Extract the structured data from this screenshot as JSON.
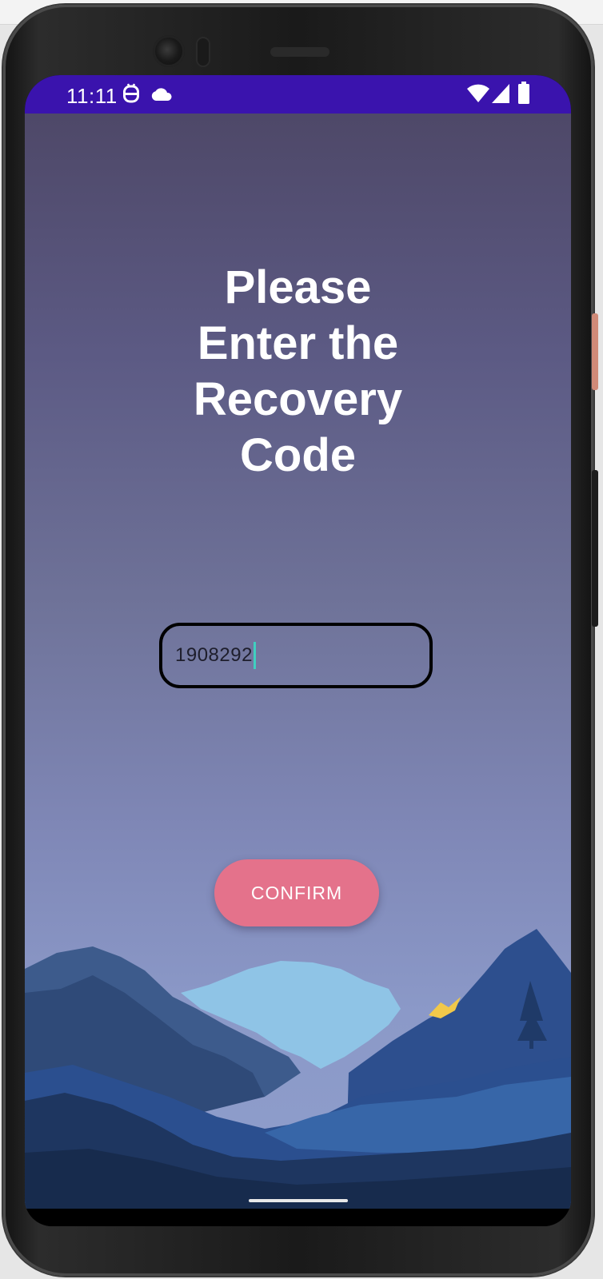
{
  "status_bar": {
    "time": "11:11",
    "left_icons": [
      "system-notification-icon",
      "cloud-icon"
    ],
    "right_icons": [
      "wifi-icon",
      "cellular-signal-icon",
      "battery-icon"
    ],
    "background_color": "#3a13ad"
  },
  "screen": {
    "title_lines": [
      "Please",
      "Enter the",
      "Recovery",
      "Code"
    ],
    "recovery_code_input": {
      "value": "1908292",
      "placeholder": ""
    },
    "confirm_button": {
      "label": "CONFIRM",
      "color": "#e4728b"
    }
  },
  "colors": {
    "background_top": "#4e4868",
    "background_bottom": "#8f9ecb",
    "title_text": "#ffffff",
    "input_border": "#000000",
    "caret": "#40d0c0"
  },
  "decor": {
    "background_illustration": "mountain-landscape-illustration"
  }
}
